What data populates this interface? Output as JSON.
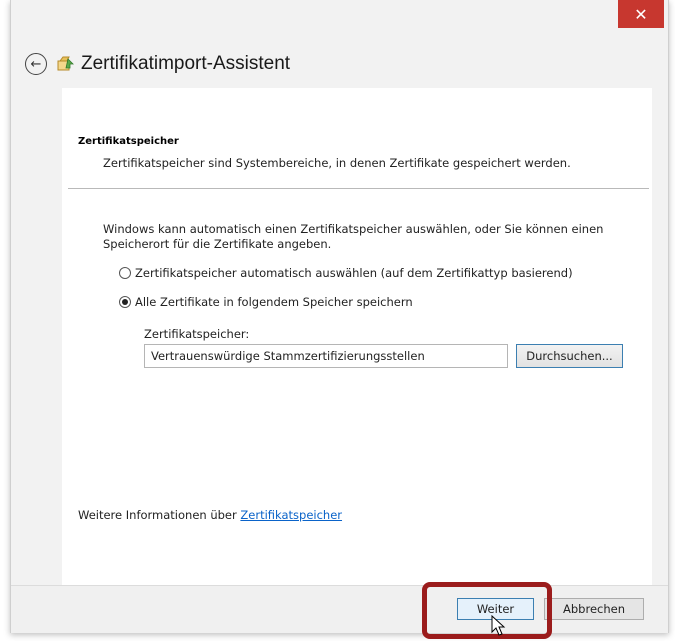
{
  "window": {
    "close_glyph": "✕",
    "title": "Zertifikatimport-Assistent",
    "back_glyph": "←"
  },
  "content": {
    "section_title": "Zertifikatspeicher",
    "section_desc": "Zertifikatspeicher sind Systembereiche, in denen Zertifikate gespeichert werden.",
    "intro": "Windows kann automatisch einen Zertifikatspeicher auswählen, oder Sie können einen Speicherort für die Zertifikate angeben.",
    "radio_auto_label": "Zertifikatspeicher automatisch auswählen (auf dem Zertifikattyp basierend)",
    "radio_manual_label": "Alle Zertifikate in folgendem Speicher speichern",
    "radio_selected": "manual",
    "store_label": "Zertifikatspeicher:",
    "store_value": "Vertrauenswürdige Stammzertifizierungsstellen",
    "browse_label": "Durchsuchen...",
    "more_info_prefix": "Weitere Informationen über ",
    "more_info_link": "Zertifikatspeicher"
  },
  "footer": {
    "next_label": "Weiter",
    "cancel_label": "Abbrechen"
  },
  "colors": {
    "close_bg": "#c7372f",
    "highlight": "#9b1c1c",
    "link": "#0a63c9"
  },
  "icons": [
    "back-arrow-icon",
    "certificate-wizard-icon",
    "close-icon",
    "mouse-cursor-icon"
  ]
}
